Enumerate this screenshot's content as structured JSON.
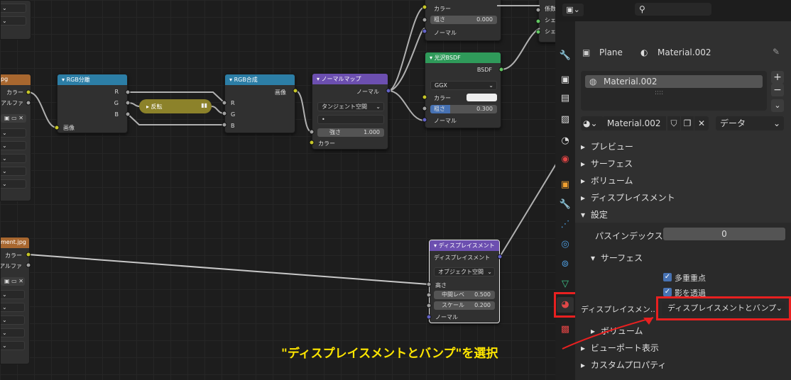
{
  "nodes": {
    "img_left_top": {
      "title": "pg",
      "out_color": "カラー",
      "out_alpha": "アルファ"
    },
    "sep_rgb": {
      "title": "RGB分離",
      "in_image": "画像",
      "out_r": "R",
      "out_g": "G",
      "out_b": "B"
    },
    "invert": {
      "title": "▸ 反転"
    },
    "comb_rgb": {
      "title": "RGB合成",
      "out_image": "画像",
      "in_r": "R",
      "in_g": "G",
      "in_b": "B"
    },
    "normal_map": {
      "title": "ノーマルマップ",
      "out_normal": "ノーマル",
      "space": "タンジェント空間",
      "uv": "•",
      "strength_label": "強さ",
      "strength": "1.000",
      "in_color": "カラー"
    },
    "top_bsdf": {
      "color": "カラー",
      "rough_label": "粗さ",
      "rough": "0.000",
      "normal": "ノーマル"
    },
    "glossy": {
      "title": "光沢BSDF",
      "out": "BSDF",
      "dist": "GGX",
      "color": "カラー",
      "rough_label": "粗さ",
      "rough": "0.300",
      "normal": "ノーマル"
    },
    "top_right": {
      "l1": "係数",
      "l2": "シェ",
      "l3": "シェ"
    },
    "img_left_bottom": {
      "title": "ment.jpg",
      "out_color": "カラー",
      "out_alpha": "アルファ"
    },
    "displacement": {
      "title": "ディスプレイスメント",
      "out": "ディスプレイスメント",
      "space": "オブジェクト空間",
      "height": "高さ",
      "mid_label": "中間レベ",
      "mid": "0.500",
      "scale_label": "スケール",
      "scale": "0.200",
      "normal": "ノーマル"
    }
  },
  "properties": {
    "object_name": "Plane",
    "material_name": "Material.002",
    "slot_name": "Material.002",
    "slot_dots": "::::",
    "browse_name": "Material.002",
    "link": "データ",
    "panels": {
      "preview": "プレビュー",
      "surface": "サーフェス",
      "volume": "ボリューム",
      "displacement": "ディスプレイスメント",
      "settings": "設定"
    },
    "pass_index_label": "パスインデックス",
    "pass_index": "0",
    "sub_surface": "サーフェス",
    "multi_importance": "多重重点",
    "transparent_shadow": "影を透過",
    "displacement_method_label": "ディスプレイスメン...",
    "displacement_method": "ディスプレイスメントとバンプ",
    "sub_volume": "ボリューム",
    "viewport_display": "ビューポート表示",
    "custom_props": "カスタムプロパティ"
  },
  "annotation": "\"ディスプレイスメントとバンプ\"を選択",
  "colors": {
    "annotation": "#ffe600",
    "highlight": "#e82020",
    "accent": "#4772b3"
  }
}
